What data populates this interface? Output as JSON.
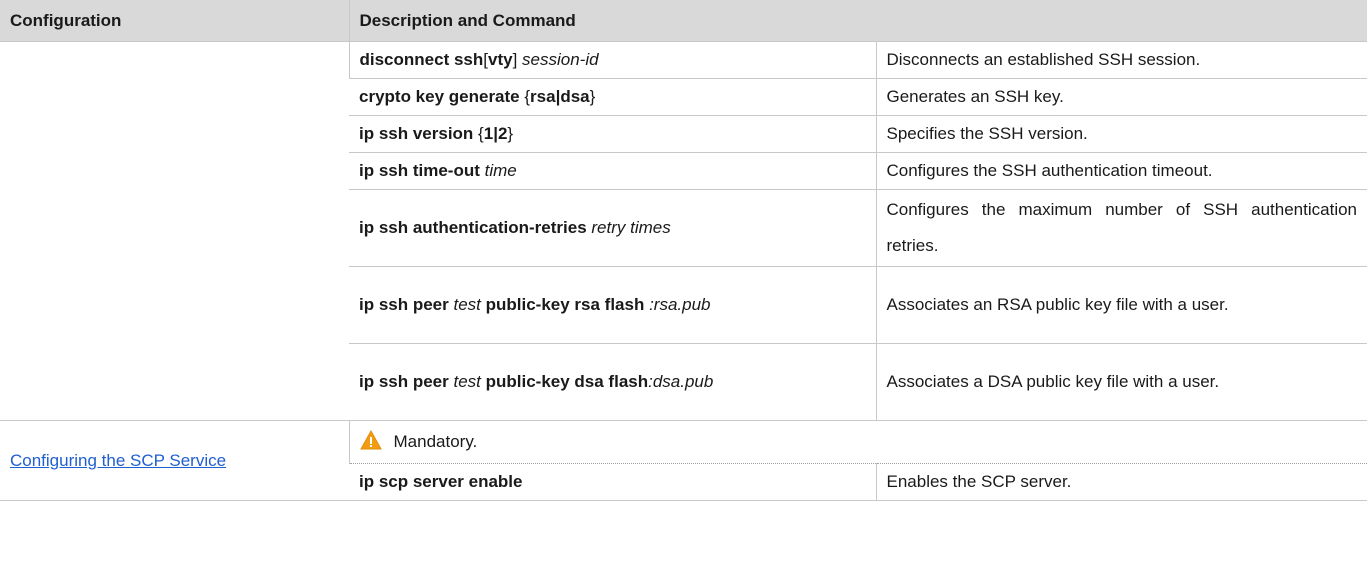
{
  "table": {
    "headers": [
      "Configuration",
      "Description and Command"
    ],
    "ssh_rows": [
      {
        "cmd_parts": [
          [
            "b",
            "disconnect ssh"
          ],
          [
            "n",
            "["
          ],
          [
            "b",
            "vty"
          ],
          [
            "n",
            "] "
          ],
          [
            "i",
            "session-id"
          ]
        ],
        "desc": "Disconnects an established SSH session."
      },
      {
        "cmd_parts": [
          [
            "b",
            "crypto key generate "
          ],
          [
            "n",
            "{"
          ],
          [
            "b",
            "rsa|dsa"
          ],
          [
            "n",
            "}"
          ]
        ],
        "desc": "Generates an SSH key."
      },
      {
        "cmd_parts": [
          [
            "b",
            "ip ssh version "
          ],
          [
            "n",
            "{"
          ],
          [
            "b",
            "1|2"
          ],
          [
            "n",
            "}"
          ]
        ],
        "desc": "Specifies the SSH version."
      },
      {
        "cmd_parts": [
          [
            "b",
            "ip ssh time-out "
          ],
          [
            "i",
            "time"
          ]
        ],
        "desc": "Configures the SSH authentication timeout."
      },
      {
        "cmd_parts": [
          [
            "b",
            "ip ssh authentication-retries "
          ],
          [
            "i",
            "retry times"
          ]
        ],
        "desc": "Configures the maximum number of SSH authentication retries."
      },
      {
        "cmd_parts": [
          [
            "b",
            "ip ssh peer "
          ],
          [
            "i",
            "test"
          ],
          [
            "b",
            " public-key rsa flash "
          ],
          [
            "i",
            ":rsa.pub"
          ]
        ],
        "desc": "Associates an RSA public key file with a user."
      },
      {
        "cmd_parts": [
          [
            "b",
            "ip ssh peer "
          ],
          [
            "i",
            "test"
          ],
          [
            "b",
            " public-key dsa flash"
          ],
          [
            "i",
            ":dsa.pub"
          ]
        ],
        "desc": "Associates a DSA public key file with a user."
      }
    ],
    "scp": {
      "link_label": "Configuring the SCP Service",
      "mandatory_label": "Mandatory.",
      "command": "ip scp server enable",
      "desc": "Enables the SCP server."
    }
  },
  "icons": {
    "warning": "warning-triangle-icon",
    "warning_color": "#f39c12"
  }
}
